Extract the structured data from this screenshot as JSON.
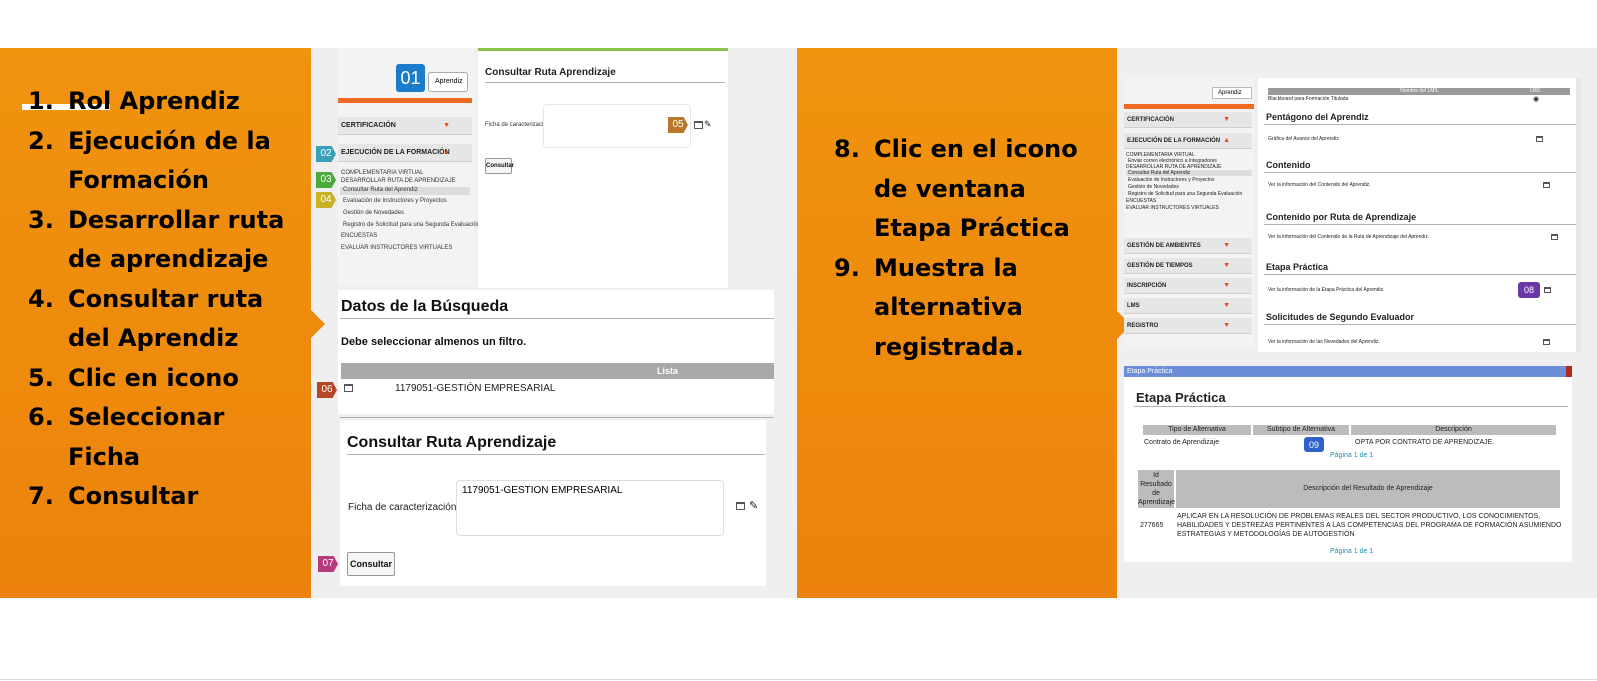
{
  "left_steps": [
    {
      "num": "1.",
      "text": "Rol Aprendiz"
    },
    {
      "num": "2.",
      "text": "Ejecución de la Formación"
    },
    {
      "num": "3.",
      "text": "Desarrollar ruta de aprendizaje"
    },
    {
      "num": "4.",
      "text": "Consultar ruta del Aprendiz"
    },
    {
      "num": "5.",
      "text": "Clic en icono"
    },
    {
      "num": "6.",
      "text": "Seleccionar Ficha"
    },
    {
      "num": "7.",
      "text": "Consultar"
    }
  ],
  "mid_steps": [
    {
      "num": "8.",
      "text": "Clic en el icono de ventana Etapa Práctica"
    },
    {
      "num": "9.",
      "text": "Muestra la alternativa registrada."
    }
  ],
  "badges": {
    "b01": "01",
    "b02": "02",
    "b03": "03",
    "b04": "04",
    "b05": "05",
    "b06": "06",
    "b07": "07",
    "b08": "08",
    "b09": "09"
  },
  "colors": {
    "orange": "#ee8a0c",
    "badge01": "#1b7ccc",
    "badge02": "#3aa0b8",
    "badge03": "#4caa3c",
    "badge04": "#c7b227",
    "badge05": "#b9772a",
    "badge06": "#b34727",
    "badge07": "#b63a7e",
    "badge08": "#6a37a8",
    "badge09": "#2f62c9"
  },
  "shot1": {
    "role_select": "Aprendiz",
    "panel_title": "Consultar Ruta Aprendizaje",
    "ficha_label": "Ficha de caracterización*",
    "consultar_small": "Consultar",
    "menu": {
      "certificacion": "CERTIFICACIÓN",
      "ejecucion": "EJECUCIÓN DE LA FORMACIÓN",
      "sub": [
        "COMPLEMENTARIA VIRTUAL",
        "DESARROLLAR RUTA DE APRENDIZAJE",
        "Consultar Ruta del Aprendiz",
        "Evaluación de Instructores y Proyectos",
        "Gestión de Novedades",
        "Registro de Solicitud para una Segunda Evaluación",
        "ENCUESTAS",
        "EVALUAR INSTRUCTORES VIRTUALES"
      ]
    }
  },
  "shot2": {
    "title": "Datos de la Búsqueda",
    "warning": "Debe seleccionar almenos un filtro.",
    "col_header": "Lista",
    "row_value": "1179051-GESTIÓN EMPRESARIAL"
  },
  "shot3": {
    "title": "Consultar Ruta Aprendizaje",
    "ficha_label": "Ficha de caracterización*",
    "ficha_value": "1179051-GESTION EMPRESARIAL",
    "button": "Consultar"
  },
  "shot4": {
    "role_select": "Aprendiz",
    "lms_header": [
      "Nombre del LMS",
      "LMS"
    ],
    "lms_row": "Blackboard para Formación Titulada",
    "menu": {
      "certificacion": "CERTIFICACIÓN",
      "ejecucion": "EJECUCIÓN DE LA FORMACIÓN",
      "sub": [
        "COMPLEMENTARIA VIRTUAL",
        "Enviar correo electrónico a Integradores",
        "DESARROLLAR RUTA DE APRENDIZAJE",
        "Consultar Ruta del Aprendiz",
        "Evaluación de Instructores y Proyectos",
        "Gestión de Novedades",
        "Registro de Solicitud para una Segunda Evaluación",
        "ENCUESTAS",
        "EVALUAR INSTRUCTORES VIRTUALES"
      ],
      "more": [
        "GESTIÓN DE AMBIENTES",
        "GESTIÓN DE TIEMPOS",
        "INSCRIPCIÓN",
        "LMS",
        "REGISTRO"
      ]
    },
    "sections": [
      {
        "title": "Pentágono del Aprendiz",
        "desc": "Gráfica del Avance del Aprendiz"
      },
      {
        "title": "Contenido",
        "desc": "Ver la información del Contenido del Aprendiz."
      },
      {
        "title": "Contenido por Ruta de Aprendizaje",
        "desc": "Ver la información del Contenido de la Ruta de Aprendizaje del Aprendiz."
      },
      {
        "title": "Etapa Práctica",
        "desc": "Ver la información de la Etapa Práctica del Aprendiz."
      },
      {
        "title": "Solicitudes de Segundo Evaluador",
        "desc": "Ver la información de las Novedades del Aprendiz."
      }
    ]
  },
  "shot5": {
    "bar_title": "Etapa Práctica",
    "title": "Etapa Práctica",
    "headers": [
      "Tipo de Alternativa",
      "Subtipo de Alternativa",
      "Descripción"
    ],
    "row": [
      "Contrato de Aprendizaje",
      "",
      "OPTA POR CONTRATO DE APRENDIZAJE."
    ],
    "pager": "Página 1 de 1",
    "res_headers": [
      "Id Resultado de Aprendizaje",
      "Descripción del Resultado de Aprendizaje"
    ],
    "res_id": "277665",
    "res_desc": "APLICAR EN LA RESOLUCIÓN DE PROBLEMAS REALES DEL SECTOR PRODUCTIVO, LOS CONOCIMIENTOS, HABILIDADES Y DESTREZAS PERTINENTES A LAS COMPETENCIAS DEL PROGRAMA DE FORMACIÓN ASUMIENDO ESTRATEGIAS Y METODOLOGÍAS DE AUTOGESTIÓN",
    "pager2": "Página 1 de 1"
  }
}
